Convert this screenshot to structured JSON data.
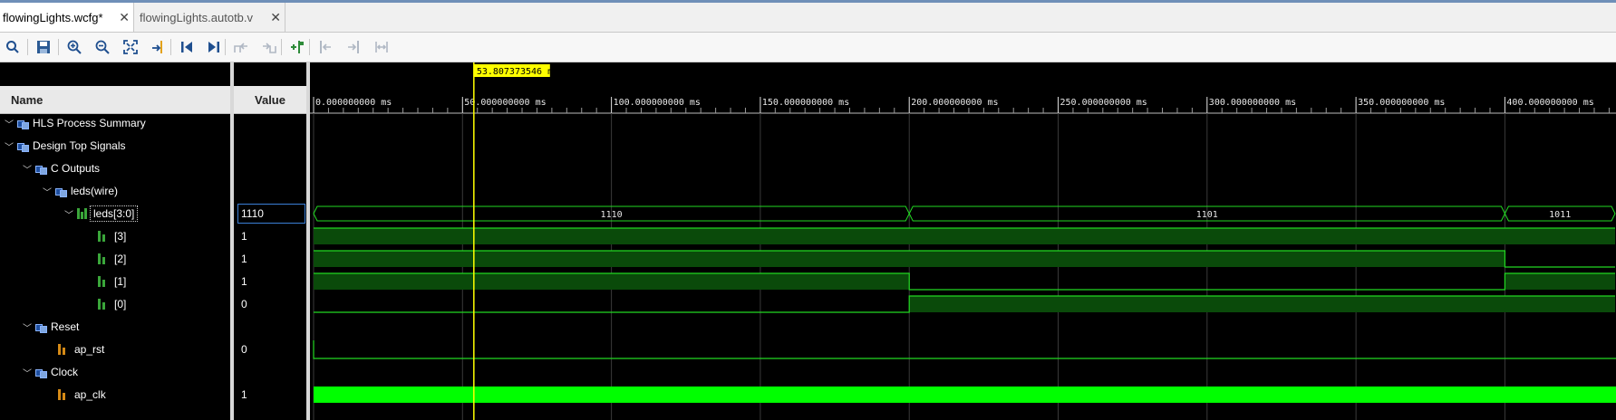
{
  "tabs": [
    {
      "label": "flowingLights.wcfg*",
      "active": true
    },
    {
      "label": "flowingLights.autotb.v",
      "active": false
    }
  ],
  "toolbar": {
    "icons": [
      "search-icon",
      "save-icon",
      "zoom-in-icon",
      "zoom-out-icon",
      "zoom-fit-icon",
      "go-to-cursor-icon",
      "go-to-time-zero-icon",
      "go-to-last-time-icon",
      "previous-transition-icon",
      "next-transition-icon",
      "add-marker-icon",
      "previous-marker-icon",
      "next-marker-icon",
      "swap-cursors-icon"
    ]
  },
  "columns": {
    "name": "Name",
    "value": "Value"
  },
  "tree": [
    {
      "label": "HLS Process Summary",
      "value": ""
    },
    {
      "label": "Design Top Signals",
      "value": ""
    },
    {
      "label": "C Outputs",
      "value": ""
    },
    {
      "label": "leds(wire)",
      "value": ""
    },
    {
      "label": "leds[3:0]",
      "value": "1110"
    },
    {
      "label": "[3]",
      "value": "1"
    },
    {
      "label": "[2]",
      "value": "1"
    },
    {
      "label": "[1]",
      "value": "1"
    },
    {
      "label": "[0]",
      "value": "0"
    },
    {
      "label": "Reset",
      "value": ""
    },
    {
      "label": "ap_rst",
      "value": "0"
    },
    {
      "label": "Clock",
      "value": ""
    },
    {
      "label": "ap_clk",
      "value": "1"
    }
  ],
  "cursor": {
    "label": "53.807373546 ms",
    "time_ms": 53.807373546
  },
  "timeline": {
    "unit": "ms",
    "ticks": [
      {
        "t": 0,
        "label": "0.000000000 ms"
      },
      {
        "t": 50,
        "label": "50.000000000 ms"
      },
      {
        "t": 100,
        "label": "100.000000000 ms"
      },
      {
        "t": 150,
        "label": "150.000000000 ms"
      },
      {
        "t": 200,
        "label": "200.000000000 ms"
      },
      {
        "t": 250,
        "label": "250.000000000 ms"
      },
      {
        "t": 300,
        "label": "300.000000000 ms"
      },
      {
        "t": 350,
        "label": "350.000000000 ms"
      },
      {
        "t": 400,
        "label": "400.000000000 ms"
      }
    ],
    "view_end_ms": 437
  },
  "bus": {
    "segments": [
      {
        "start": 0,
        "end": 200,
        "label": "1110"
      },
      {
        "start": 200,
        "end": 400,
        "label": "1101"
      },
      {
        "start": 400,
        "end": 437,
        "label": "1011"
      }
    ]
  },
  "bits": [
    {
      "name": "[3]",
      "levels": [
        [
          0,
          437,
          1
        ]
      ]
    },
    {
      "name": "[2]",
      "levels": [
        [
          0,
          400,
          1
        ],
        [
          400,
          437,
          0
        ]
      ]
    },
    {
      "name": "[1]",
      "levels": [
        [
          0,
          200,
          1
        ],
        [
          200,
          400,
          0
        ],
        [
          400,
          437,
          1
        ]
      ]
    },
    {
      "name": "[0]",
      "levels": [
        [
          0,
          200,
          0
        ],
        [
          200,
          437,
          1
        ]
      ]
    }
  ],
  "colors": {
    "wave": "#22d822",
    "fill": "#0a4a0a",
    "clock": "#00ff00",
    "cursor": "#ffff00",
    "grid": "#3a3a3a"
  }
}
